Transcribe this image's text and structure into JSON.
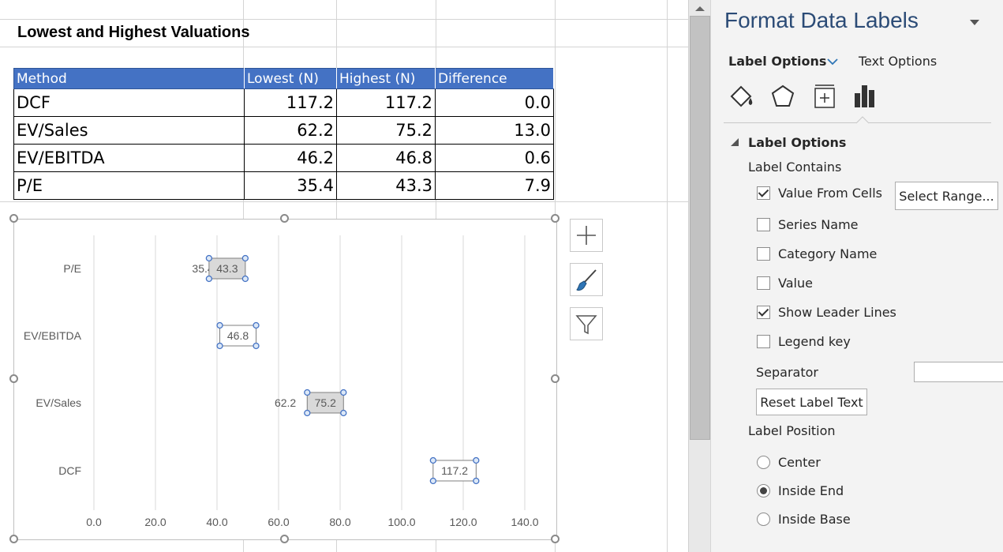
{
  "sheet": {
    "title": "Lowest and Highest Valuations",
    "table": {
      "headers": [
        "Method",
        "Lowest (N)",
        "Highest (N)",
        "Difference"
      ],
      "rows": [
        [
          "DCF",
          "117.2",
          "117.2",
          "0.0"
        ],
        [
          "EV/Sales",
          "62.2",
          "75.2",
          "13.0"
        ],
        [
          "EV/EBITDA",
          "46.2",
          "46.8",
          "0.6"
        ],
        [
          "P/E",
          "35.4",
          "43.3",
          "7.9"
        ]
      ]
    }
  },
  "chart_data": {
    "type": "scatter",
    "title": "",
    "categories": [
      "P/E",
      "EV/EBITDA",
      "EV/Sales",
      "DCF"
    ],
    "series": [
      {
        "values": [
          35.4,
          46.2,
          62.2,
          117.2
        ],
        "labels": [
          "35.4",
          "46.2",
          "62.2",
          "117.2"
        ]
      },
      {
        "values": [
          43.3,
          46.8,
          75.2,
          117.2
        ],
        "labels": [
          "43.3",
          "46.8",
          "75.2",
          "117.2"
        ]
      }
    ],
    "xlim": [
      0,
      140
    ],
    "xticks": [
      "0.0",
      "20.0",
      "40.0",
      "60.0",
      "80.0",
      "100.0",
      "120.0",
      "140.0"
    ],
    "grid": true,
    "label_color": "#595959",
    "gridline_color": "#d9d9d9"
  },
  "chart_buttons": {
    "elements": "chart-elements",
    "styles": "chart-styles",
    "filters": "chart-filters"
  },
  "pane": {
    "title": "Format Data Labels",
    "tab_label_options": "Label Options",
    "tab_text_options": "Text Options",
    "section_header": "Label Options",
    "label_contains": "Label Contains",
    "options": [
      {
        "label": "Value From Cells",
        "checked": true
      },
      {
        "label": "Series Name",
        "checked": false
      },
      {
        "label": "Category Name",
        "checked": false
      },
      {
        "label": "Value",
        "checked": false
      },
      {
        "label": "Show Leader Lines",
        "checked": true
      },
      {
        "label": "Legend key",
        "checked": false
      }
    ],
    "select_range": "Select Range...",
    "separator": "Separator",
    "separator_value": "",
    "reset_label_text": "Reset Label Text",
    "label_position": "Label Position",
    "positions": [
      {
        "label": "Center",
        "selected": false
      },
      {
        "label": "Inside End",
        "selected": true
      },
      {
        "label": "Inside Base",
        "selected": false
      }
    ],
    "accent": "#2b4b76"
  }
}
